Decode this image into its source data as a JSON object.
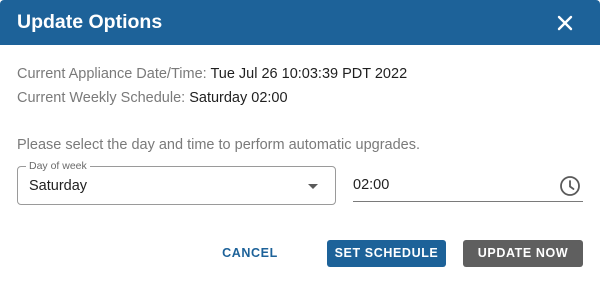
{
  "dialog": {
    "title": "Update Options",
    "close_icon": "close-icon"
  },
  "info": {
    "date_label": "Current Appliance Date/Time: ",
    "date_value": "Tue Jul 26 10:03:39 PDT 2022",
    "schedule_label": "Current Weekly Schedule: ",
    "schedule_value": "Saturday 02:00"
  },
  "instruction": "Please select the day and time to perform automatic upgrades.",
  "day_select": {
    "label": "Day of week",
    "value": "Saturday",
    "icon": "chevron-down-icon"
  },
  "time_input": {
    "value": "02:00",
    "icon": "clock-icon"
  },
  "actions": {
    "cancel_label": "CANCEL",
    "set_schedule_label": "SET SCHEDULE",
    "update_now_label": "UPDATE NOW"
  },
  "colors": {
    "primary": "#1d6299",
    "secondary_button": "#5f5f5f",
    "muted_text": "#7a7a7a"
  }
}
